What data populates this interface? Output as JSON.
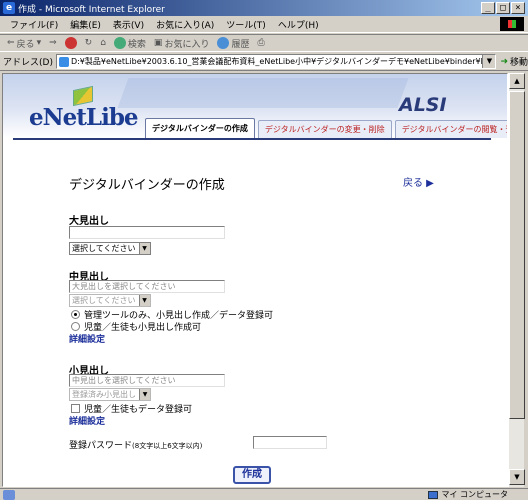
{
  "window": {
    "title": "作成 - Microsoft Internet Explorer",
    "controls": [
      "_",
      "□",
      "×"
    ]
  },
  "menu": [
    "ファイル(F)",
    "編集(E)",
    "表示(V)",
    "お気に入り(A)",
    "ツール(T)",
    "ヘルプ(H)"
  ],
  "toolbar": {
    "back": "戻る",
    "search": "検索",
    "favorites": "お気に入り",
    "history": "履歴"
  },
  "address": {
    "label": "アドレス(D)",
    "value": "D:¥製品¥eNetLibe¥2003.6.10_営業会議配布資料_eNetLibe小中¥デジタルバインダーデモ¥eNetLibe¥binder¥build.html",
    "go": "移動"
  },
  "header": {
    "logo": "eNetLibe",
    "brand": "ALSI",
    "tabs": [
      {
        "label": "デジタルバインダーの作成",
        "active": true
      },
      {
        "label": "デジタルバインダーの変更・削除",
        "active": false
      },
      {
        "label": "デジタルバインダーの閲覧・登録",
        "active": false
      }
    ]
  },
  "main": {
    "title": "デジタルバインダーの作成",
    "back_link": "戻る ▶",
    "major": {
      "label": "大見出し",
      "select": "選択してください"
    },
    "middle": {
      "label": "中見出し",
      "placeholder": "大見出しを選択してください",
      "select": "選択してください",
      "options": [
        "管理ツールのみ、小見出し作成／データ登録可",
        "児童／生徒も小見出し作成可"
      ],
      "detail": "詳細設定"
    },
    "minor": {
      "label": "小見出し",
      "placeholder": "中見出しを選択してください",
      "select": "登録済み小見出し",
      "checkbox": "児童／生徒もデータ登録可",
      "detail": "詳細設定"
    },
    "password": {
      "label": "登録パスワード",
      "hint": "(8文字以上6文字以内)"
    },
    "create_button": "作成"
  },
  "status": {
    "zone": "マイ コンピュータ"
  }
}
